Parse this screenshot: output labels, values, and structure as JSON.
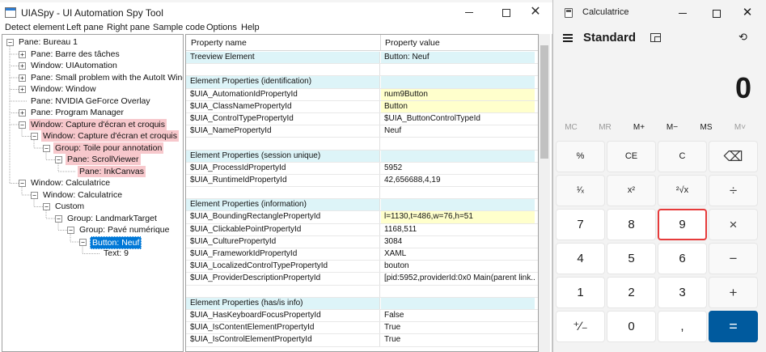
{
  "spy": {
    "title": "UIASpy - UI Automation Spy Tool",
    "menu": [
      "Detect element",
      "Left pane",
      "Right pane",
      "Sample code",
      "Options",
      "Help"
    ],
    "tree": [
      {
        "label": "Pane: Bureau 1",
        "exp": "−",
        "state": ""
      },
      {
        "label": "Pane: Barre des tâches",
        "exp": "+",
        "state": ""
      },
      {
        "label": "Window: UIAutomation",
        "exp": "+",
        "state": ""
      },
      {
        "label": "Pane: Small problem with the AutoIt Window",
        "exp": "+",
        "state": ""
      },
      {
        "label": "Window: Window",
        "exp": "+",
        "state": ""
      },
      {
        "label": "Pane: NVIDIA GeForce Overlay",
        "exp": "",
        "state": ""
      },
      {
        "label": "Pane: Program Manager",
        "exp": "+",
        "state": ""
      },
      {
        "label": "Window: Capture d'écran et croquis",
        "exp": "−",
        "state": "hl"
      },
      {
        "label": "Window: Capture d'écran et croquis",
        "exp": "−",
        "state": "hl"
      },
      {
        "label": "Group: Toile pour annotation",
        "exp": "−",
        "state": "hl"
      },
      {
        "label": "Pane: ScrollViewer",
        "exp": "−",
        "state": "hl"
      },
      {
        "label": "Pane: InkCanvas",
        "exp": "",
        "state": "hl"
      },
      {
        "label": "Window: Calculatrice",
        "exp": "−",
        "state": ""
      },
      {
        "label": "Window: Calculatrice",
        "exp": "−",
        "state": ""
      },
      {
        "label": "Custom",
        "exp": "−",
        "state": ""
      },
      {
        "label": "Group: LandmarkTarget",
        "exp": "−",
        "state": ""
      },
      {
        "label": "Group: Pavé numérique",
        "exp": "−",
        "state": ""
      },
      {
        "label": "Button: Neuf",
        "exp": "−",
        "state": "sel"
      },
      {
        "label": "Text: 9",
        "exp": "",
        "state": ""
      }
    ],
    "props_header": {
      "name": "Property name",
      "value": "Property value"
    },
    "props": [
      {
        "name": "Treeview Element",
        "value": "Button: Neuf",
        "kind": "sect",
        "yl": false
      },
      {
        "name": "",
        "value": "",
        "kind": "",
        "yl": false
      },
      {
        "name": "Element Properties (identification)",
        "value": "",
        "kind": "sect",
        "yl": false
      },
      {
        "name": "$UIA_AutomationIdPropertyId",
        "value": "num9Button",
        "kind": "",
        "yl": true
      },
      {
        "name": "$UIA_ClassNamePropertyId",
        "value": "Button",
        "kind": "",
        "yl": true
      },
      {
        "name": "$UIA_ControlTypePropertyId",
        "value": "$UIA_ButtonControlTypeId",
        "kind": "",
        "yl": false
      },
      {
        "name": "$UIA_NamePropertyId",
        "value": "Neuf",
        "kind": "",
        "yl": false
      },
      {
        "name": "",
        "value": "",
        "kind": "",
        "yl": false
      },
      {
        "name": "Element Properties (session unique)",
        "value": "",
        "kind": "sect",
        "yl": false
      },
      {
        "name": "$UIA_ProcessIdPropertyId",
        "value": "5952",
        "kind": "",
        "yl": false
      },
      {
        "name": "$UIA_RuntimeIdPropertyId",
        "value": "42,656688,4,19",
        "kind": "",
        "yl": false
      },
      {
        "name": "",
        "value": "",
        "kind": "",
        "yl": false
      },
      {
        "name": "Element Properties (information)",
        "value": "",
        "kind": "sect",
        "yl": false
      },
      {
        "name": "$UIA_BoundingRectanglePropertyId",
        "value": "l=1130,t=486,w=76,h=51",
        "kind": "",
        "yl": true
      },
      {
        "name": "$UIA_ClickablePointPropertyId",
        "value": "1168,511",
        "kind": "",
        "yl": false
      },
      {
        "name": "$UIA_CulturePropertyId",
        "value": "3084",
        "kind": "",
        "yl": false
      },
      {
        "name": "$UIA_FrameworkIdPropertyId",
        "value": "XAML",
        "kind": "",
        "yl": false
      },
      {
        "name": "$UIA_LocalizedControlTypePropertyId",
        "value": "bouton",
        "kind": "",
        "yl": false
      },
      {
        "name": "$UIA_ProviderDescriptionPropertyId",
        "value": "[pid:5952,providerId:0x0 Main(parent link...",
        "kind": "",
        "yl": false
      },
      {
        "name": "",
        "value": "",
        "kind": "",
        "yl": false
      },
      {
        "name": "Element Properties (has/is info)",
        "value": "",
        "kind": "sect",
        "yl": false
      },
      {
        "name": "$UIA_HasKeyboardFocusPropertyId",
        "value": "False",
        "kind": "",
        "yl": false
      },
      {
        "name": "$UIA_IsContentElementPropertyId",
        "value": "True",
        "kind": "",
        "yl": false
      },
      {
        "name": "$UIA_IsControlElementPropertyId",
        "value": "True",
        "kind": "",
        "yl": false
      }
    ]
  },
  "calc": {
    "title": "Calculatrice",
    "mode": "Standard",
    "display": "0",
    "memory": [
      "MC",
      "MR",
      "M+",
      "M−",
      "MS",
      "M˅"
    ],
    "keys": [
      [
        "%",
        "CE",
        "C",
        "⌫"
      ],
      [
        "¹⁄ₓ",
        "x²",
        "²√x",
        "÷"
      ],
      [
        "7",
        "8",
        "9",
        "×"
      ],
      [
        "4",
        "5",
        "6",
        "−"
      ],
      [
        "1",
        "2",
        "3",
        "+"
      ],
      [
        "⁺∕₋",
        "0",
        ",",
        "="
      ]
    ],
    "colors": {
      "accent": "#005a9e",
      "highlight_border": "#e63b3b",
      "tree_highlight": "#f7c8cc",
      "selection": "#0078d7"
    }
  }
}
